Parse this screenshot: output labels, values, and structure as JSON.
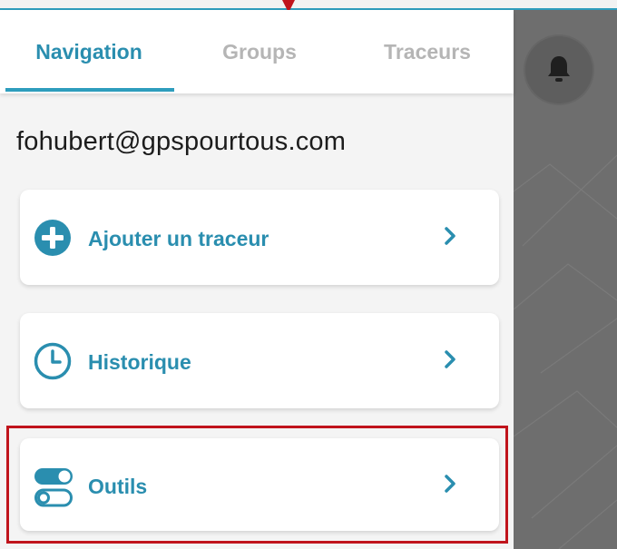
{
  "tabs": [
    {
      "label": "Navigation",
      "active": true
    },
    {
      "label": "Groups",
      "active": false
    },
    {
      "label": "Traceurs",
      "active": false
    }
  ],
  "account": {
    "email": "fohubert@gpspourtous.com"
  },
  "menu": [
    {
      "label": "Ajouter un traceur",
      "icon": "add-circle-icon"
    },
    {
      "label": "Historique",
      "icon": "clock-icon"
    },
    {
      "label": "Outils",
      "icon": "toggles-icon"
    }
  ],
  "colors": {
    "accent": "#2a8eaf",
    "highlight": "#c0141c",
    "inactive_tab": "#b5b5b5",
    "map_background": "#6e6e6e"
  }
}
